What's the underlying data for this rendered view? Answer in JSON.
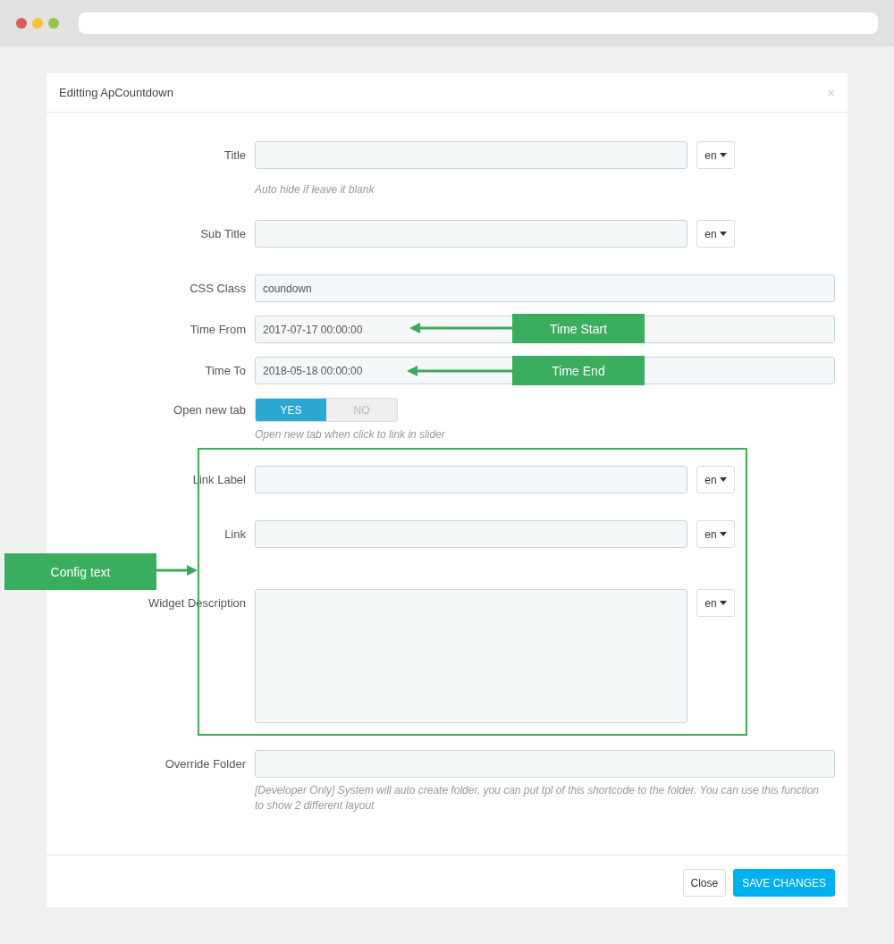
{
  "modal": {
    "title": "Editting ApCountdown",
    "close": "×"
  },
  "fields": [
    {
      "kind": "text",
      "label": "Title",
      "lang": "en",
      "help": "Auto hide if leave it blank"
    },
    {
      "kind": "text",
      "label": "Sub Title",
      "lang": "en"
    },
    {
      "kind": "text",
      "label": "CSS Class",
      "value": "coundown"
    },
    {
      "kind": "text",
      "label": "Time From",
      "value": "2017-07-17 00:00:00"
    },
    {
      "kind": "text",
      "label": "Time To",
      "value": "2018-05-18 00:00:00"
    },
    {
      "kind": "toggle",
      "label": "Open new tab",
      "options": [
        {
          "label": "YES",
          "selected": true
        },
        {
          "label": "NO",
          "selected": false
        }
      ],
      "help": "Open new tab when click to link in slider"
    },
    {
      "kind": "text",
      "label": "Link Label",
      "lang": "en"
    },
    {
      "kind": "text",
      "label": "Link",
      "lang": "en"
    },
    {
      "kind": "textarea",
      "label": "Widget Description",
      "lang": "en"
    },
    {
      "kind": "text",
      "label": "Override Folder",
      "help": "[Developer Only] System will auto create folder, you can put tpl of this shortcode to the folder. You can use this function to show 2 different layout"
    }
  ],
  "footer": {
    "buttons": [
      {
        "label": "Close",
        "kind": "default"
      },
      {
        "label": "SAVE CHANGES",
        "kind": "primary"
      }
    ]
  },
  "annotations": [
    {
      "kind": "callout",
      "text": "Time Start"
    },
    {
      "kind": "callout",
      "text": "Time End"
    },
    {
      "kind": "callout",
      "text": "Config text"
    },
    {
      "kind": "frame"
    }
  ]
}
